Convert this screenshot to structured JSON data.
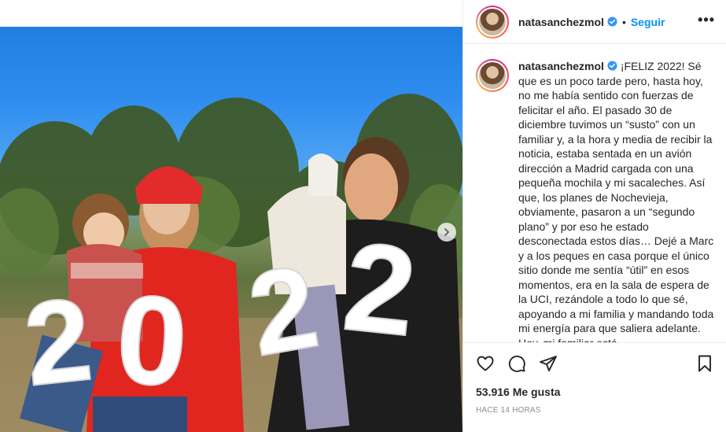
{
  "post": {
    "username": "natasanchezmol",
    "verified": true,
    "follow_label": "Seguir",
    "separator": "•",
    "more_label": "•••",
    "photo_text": "2022"
  },
  "caption": {
    "username": "natasanchezmol",
    "text": "¡FELIZ 2022! Sé que es un poco tarde pero, hasta hoy, no me había sentido con fuerzas de felicitar el año. El pasado 30 de diciembre tuvimos un “susto” con un familiar y, a la hora y media de recibir la noticia, estaba sentada en un avión dirección a Madrid cargada con una pequeña mochila y mi sacaleches. Así que, los planes de Nochevieja, obviamente, pasaron a un “segundo plano” y por eso he estado desconectada estos días… Dejé a Marc y a los peques en casa porque el único sitio donde me sentía “útil” en esos momentos, era en la sala de espera de la UCI, rezándole a todo lo que sé, apoyando a mi familia y mandando toda mi energía para que saliera adelante. Hoy, mi familiar está"
  },
  "actions": {
    "like_icon": "heart-icon",
    "comment_icon": "comment-icon",
    "share_icon": "paper-plane-icon",
    "save_icon": "bookmark-icon"
  },
  "stats": {
    "likes": "53.916 Me gusta",
    "timestamp": "HACE 14 HORAS"
  },
  "colors": {
    "link_blue": "#0095f6",
    "verified_blue": "#3897f0",
    "text": "#262626",
    "muted": "#8e8e8e",
    "border": "#efefef"
  }
}
